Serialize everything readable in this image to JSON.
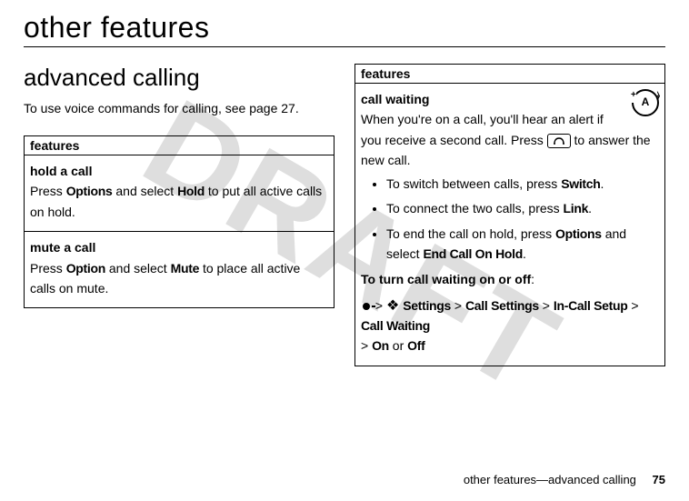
{
  "watermark": "DRAFT",
  "title": "other features",
  "section": "advanced calling",
  "intro_prefix": "To use voice commands for calling, see page ",
  "intro_page": "27",
  "intro_suffix": ".",
  "left_box": {
    "header": "features",
    "rows": [
      {
        "title": "hold a call",
        "p1a": "Press ",
        "k1": "Options",
        "p1b": " and select ",
        "k2": "Hold",
        "p1c": " to put all active calls on hold."
      },
      {
        "title": "mute a call",
        "p1a": "Press ",
        "k1": "Option",
        "p1b": " and select ",
        "k2": "Mute",
        "p1c": " to place all active calls on mute."
      }
    ]
  },
  "right_box": {
    "header": "features",
    "cell": {
      "title": "call waiting",
      "icon_letter": "A",
      "p1a": "When you're on a call, you'll hear an alert if you receive a second call. Press ",
      "p1b": " to answer the new call.",
      "bullets": [
        {
          "a": "To switch between calls, press ",
          "k": "Switch",
          "b": "."
        },
        {
          "a": "To connect the two calls, press ",
          "k": "Link",
          "b": "."
        },
        {
          "a": "To end the call on hold, press ",
          "k": "Options",
          "b": " and select ",
          "k2": "End Call On Hold",
          "c": "."
        }
      ],
      "toggle_label": "To turn call waiting on or off",
      "path": {
        "settings": "Settings",
        "call_settings": "Call Settings",
        "incall": "In-Call Setup",
        "cw": "Call Waiting",
        "on": "On",
        "or": " or ",
        "off": "Off"
      }
    }
  },
  "footer": {
    "text": "other features—advanced calling",
    "page": "75"
  }
}
